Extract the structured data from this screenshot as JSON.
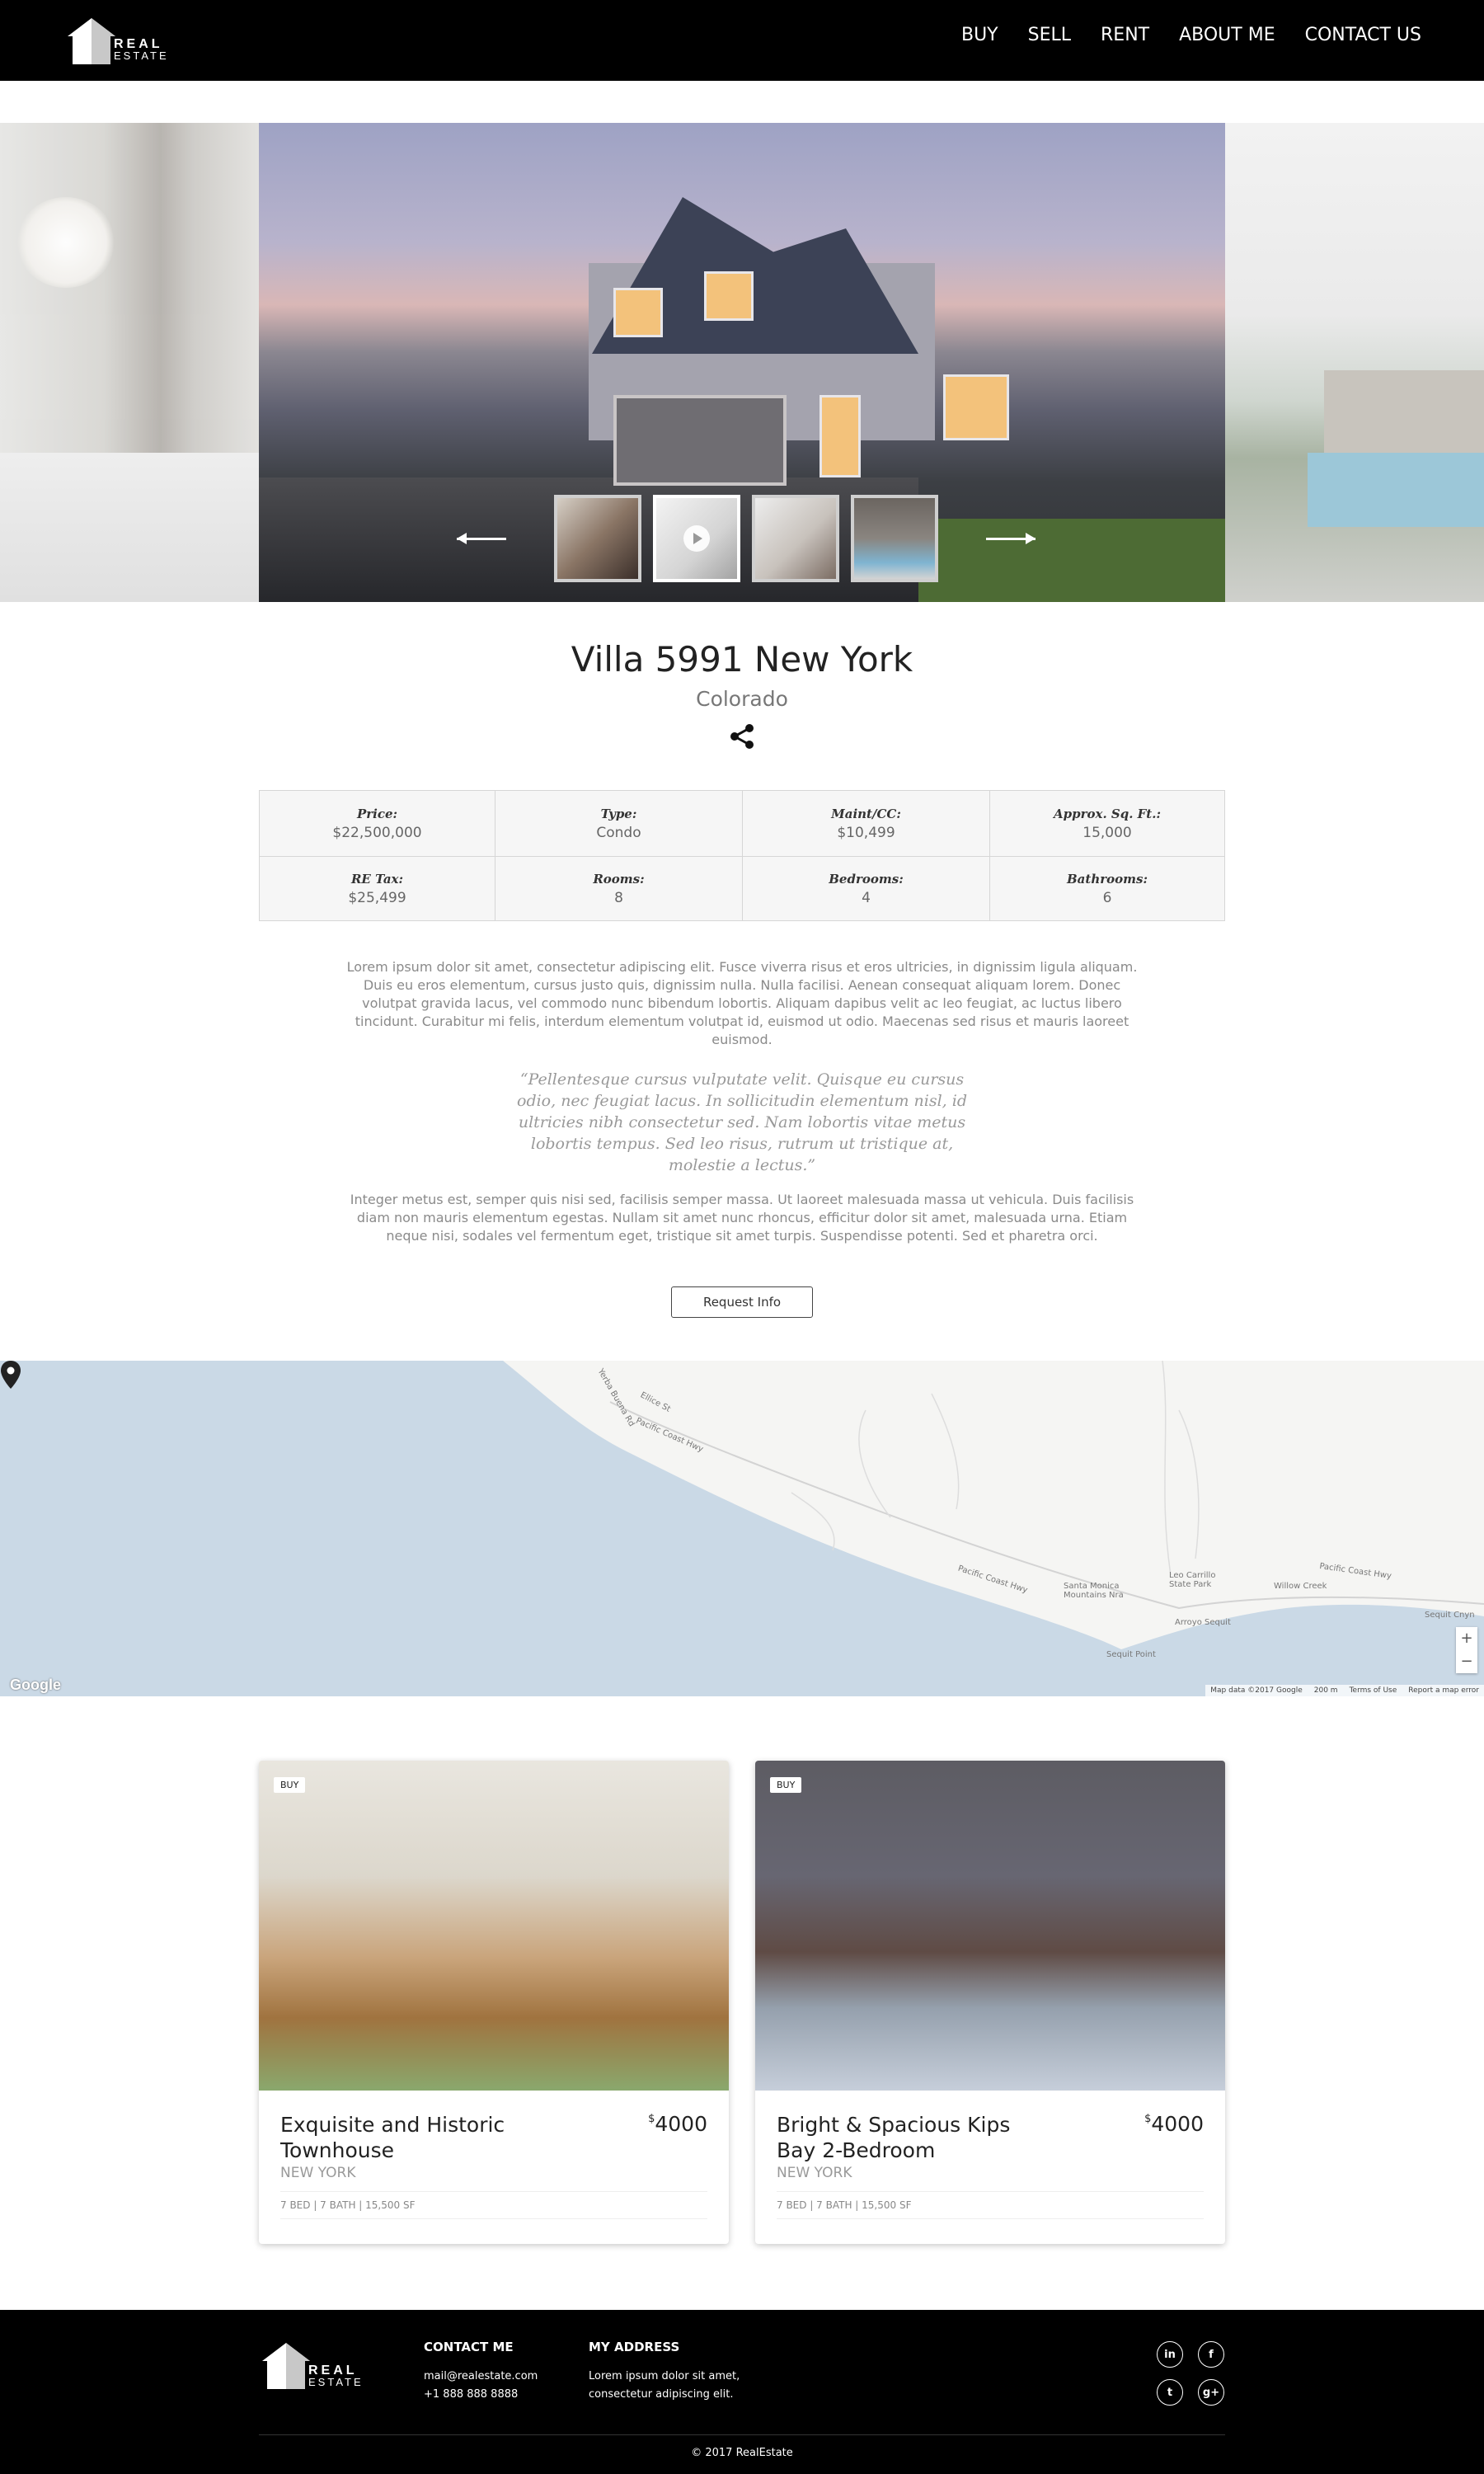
{
  "brand": {
    "line1": "REAL",
    "line2": "ESTATE"
  },
  "nav": [
    "BUY",
    "SELL",
    "RENT",
    "ABOUT ME",
    "CONTACT US"
  ],
  "listing": {
    "title": "Villa 5991 New York",
    "location": "Colorado",
    "details": [
      {
        "label": "Price:",
        "value": "$22,500,000"
      },
      {
        "label": "Type:",
        "value": "Condo"
      },
      {
        "label": "Maint/CC:",
        "value": "$10,499"
      },
      {
        "label": "Approx. Sq. Ft.:",
        "value": "15,000"
      },
      {
        "label": "RE Tax:",
        "value": "$25,499"
      },
      {
        "label": "Rooms:",
        "value": "8"
      },
      {
        "label": "Bedrooms:",
        "value": "4"
      },
      {
        "label": "Bathrooms:",
        "value": "6"
      }
    ],
    "para1": "Lorem ipsum dolor sit amet, consectetur adipiscing elit. Fusce viverra risus et eros ultricies, in dignissim ligula aliquam. Duis eu eros elementum, cursus justo quis, dignissim nulla. Nulla facilisi. Aenean consequat aliquam lorem. Donec volutpat gravida lacus, vel commodo nunc bibendum lobortis. Aliquam dapibus velit ac leo feugiat, ac luctus libero tincidunt. Curabitur mi felis, interdum elementum volutpat id, euismod ut odio. Maecenas sed risus et mauris laoreet euismod.",
    "quote": "“Pellentesque cursus vulputate velit. Quisque eu cursus odio, nec feugiat lacus. In sollicitudin elementum nisl, id ultricies nibh consectetur sed. Nam lobortis vitae metus lobortis tempus. Sed leo risus, rutrum ut tristique at, molestie a lectus.”",
    "para2": "Integer metus est, semper quis nisi sed, facilisis semper massa. Ut laoreet malesuada massa ut vehicula. Duis facilisis diam non mauris elementum egestas. Nullam sit amet nunc rhoncus, efficitur dolor sit amet, malesuada urna. Etiam neque nisi, sodales vel fermentum eget, tristique sit amet turpis. Suspendisse potenti. Sed et pharetra orci.",
    "request_label": "Request Info"
  },
  "map": {
    "labels": [
      "Yerba Buena Rd",
      "Ellice St",
      "Pacific Coast Hwy",
      "Pacific Coast Hwy",
      "Santa Monica Mountains Nra",
      "Leo Carrillo State Park",
      "Willow Creek",
      "Pacific Coast Hwy",
      "Arroyo Sequit",
      "Sequit Point",
      "Sequit Cnyn"
    ],
    "google": "Google",
    "footer": [
      "Map data ©2017 Google",
      "200 m",
      "Terms of Use",
      "Report a map error"
    ],
    "zoom_in": "+",
    "zoom_out": "−"
  },
  "cards": [
    {
      "badge": "BUY",
      "name": "Exquisite and Historic Townhouse",
      "currency": "$",
      "price": "4000",
      "city": "NEW YORK",
      "spec": "7 BED | 7 BATH | 15,500 SF"
    },
    {
      "badge": "BUY",
      "name": "Bright & Spacious Kips Bay 2-Bedroom",
      "currency": "$",
      "price": "4000",
      "city": "NEW YORK",
      "spec": "7 BED | 7 BATH | 15,500 SF"
    }
  ],
  "footer": {
    "contact_title": "CONTACT ME",
    "email": "mail@realestate.com",
    "phone": "+1 888 888 8888",
    "address_title": "MY ADDRESS",
    "address1": "Lorem ipsum dolor sit amet,",
    "address2": "consectetur adipiscing elit.",
    "socials": [
      "in",
      "f",
      "t",
      "g+"
    ],
    "copyright": "© 2017 RealEstate"
  }
}
